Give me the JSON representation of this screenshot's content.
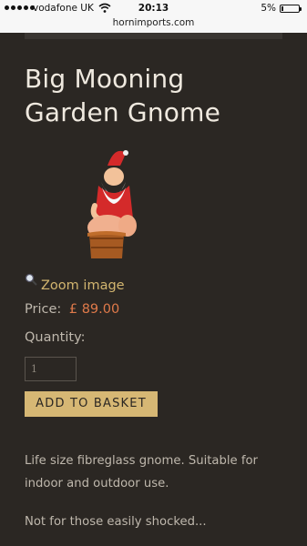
{
  "status_bar": {
    "carrier": "vodafone UK",
    "time": "20:13",
    "battery_percent": "5%",
    "url": "hornimports.com"
  },
  "product": {
    "title_line1": "Big Mooning",
    "title_line2": "Garden Gnome",
    "zoom_label": "Zoom image",
    "price_label": "Price:",
    "price_value": "£ 89.00",
    "quantity_label": "Quantity:",
    "quantity_value": "1",
    "add_to_basket_label": "ADD TO BASKET",
    "description_1": "Life size fibreglass gnome. Suitable for indoor and outdoor use.",
    "description_2": "Not for those easily shocked..."
  },
  "colors": {
    "background": "#2b2723",
    "accent": "#d6b774",
    "price": "#e07a4a",
    "text": "#bfb8ad"
  },
  "icons": {
    "signal": "signal-dots-icon",
    "wifi": "wifi-icon",
    "battery": "battery-icon",
    "zoom": "magnifier-icon"
  }
}
